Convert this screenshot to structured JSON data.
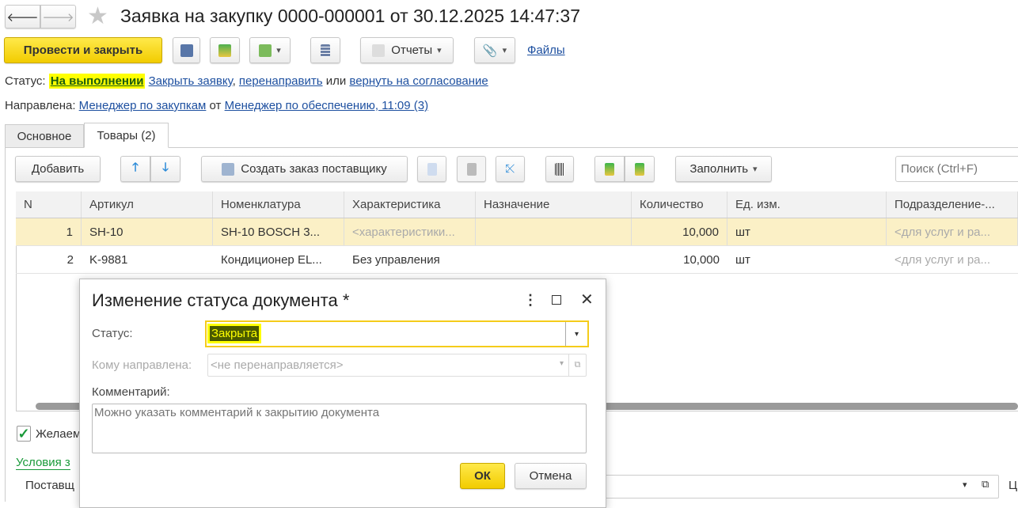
{
  "header": {
    "title": "Заявка на закупку 0000-000001 от 30.12.2025 14:47:37"
  },
  "toolbar": {
    "post_close": "Провести и закрыть",
    "reports": "Отчеты",
    "files": "Файлы"
  },
  "status": {
    "label": "Статус:",
    "value": "На выполнении",
    "close_link": "Закрыть заявку",
    "comma": ",",
    "redirect_link": "перенаправить",
    "or": "или",
    "return_link": "вернуть на согласование"
  },
  "directed": {
    "label": "Направлена:",
    "to": "Менеджер по закупкам",
    "from_word": "от",
    "from": "Менеджер по обеспечению, 11:09 (3)"
  },
  "tabs": [
    {
      "label": "Основное"
    },
    {
      "label": "Товары (2)"
    }
  ],
  "table_toolbar": {
    "add": "Добавить",
    "create_order": "Создать заказ поставщику",
    "fill": "Заполнить",
    "search_placeholder": "Поиск (Ctrl+F)"
  },
  "table": {
    "columns": [
      "N",
      "Артикул",
      "Номенклатура",
      "Характеристика",
      "Назначение",
      "Количество",
      "Ед. изм.",
      "Подразделение-..."
    ],
    "rows": [
      [
        "1",
        "SH-10",
        "SH-10 BOSCH 3...",
        "<характеристики...",
        "",
        "10,000",
        "шт",
        "<для услуг и ра..."
      ],
      [
        "2",
        "K-9881",
        "Кондиционер EL...",
        "Без управления",
        "",
        "10,000",
        "шт",
        "<для услуг и ра..."
      ]
    ]
  },
  "bottom": {
    "checkbox_label": "Желаем",
    "checkbox_checked": true,
    "conditions_link": "Условия з",
    "supplier_label": "Поставщ",
    "right_label": "Ц"
  },
  "dialog": {
    "title": "Изменение статуса документа *",
    "status_label": "Статус:",
    "status_value": "Закрыта",
    "to_label": "Кому направлена:",
    "to_placeholder": "<не перенаправляется>",
    "comment_label": "Комментарий:",
    "comment_placeholder": "Можно указать комментарий к закрытию документа",
    "ok": "ОК",
    "cancel": "Отмена"
  }
}
